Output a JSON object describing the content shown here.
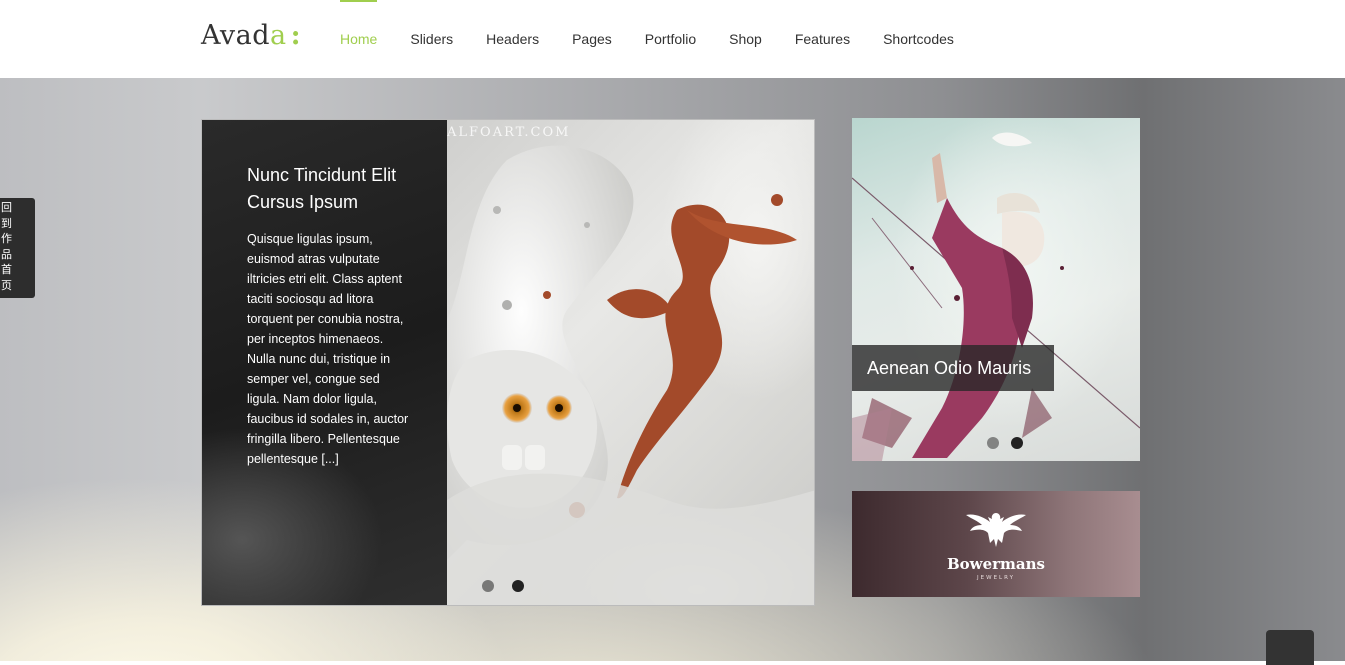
{
  "header": {
    "logo_main": "Avad",
    "logo_accent": "a",
    "logo_colon": ":",
    "nav": [
      {
        "label": "Home",
        "active": true
      },
      {
        "label": "Sliders"
      },
      {
        "label": "Headers"
      },
      {
        "label": "Pages"
      },
      {
        "label": "Portfolio"
      },
      {
        "label": "Shop"
      },
      {
        "label": "Features"
      },
      {
        "label": "Shortcodes"
      }
    ]
  },
  "side_tab": {
    "chars": [
      "回",
      "到",
      "作",
      "品",
      "首",
      "页"
    ]
  },
  "main_slider": {
    "title": "Nunc Tincidunt Elit Cursus Ipsum",
    "body": "Quisque ligulas ipsum, euismod atras vulputate iltricies etri elit. Class aptent taciti sociosqu ad litora torquent per conubia nostra, per inceptos himenaeos. Nulla nunc dui, tristique in semper vel, congue sed ligula. Nam dolor ligula, faucibus id sodales in, auctor fringilla libero. Pellentesque pellentesque [...]",
    "watermark": "ALFOART.COM",
    "slide_count": 2,
    "active_slide": 2
  },
  "side_slider": {
    "caption": "Aenean Odio Mauris",
    "slide_count": 2,
    "active_slide": 2
  },
  "banner": {
    "brand": "Bowermans",
    "subtitle": "JEWELRY"
  },
  "colors": {
    "accent": "#a0ce4e",
    "text": "#333333",
    "dark_panel": "#222222"
  },
  "icons": [
    "eagle-crest-icon",
    "back-to-top-icon"
  ]
}
